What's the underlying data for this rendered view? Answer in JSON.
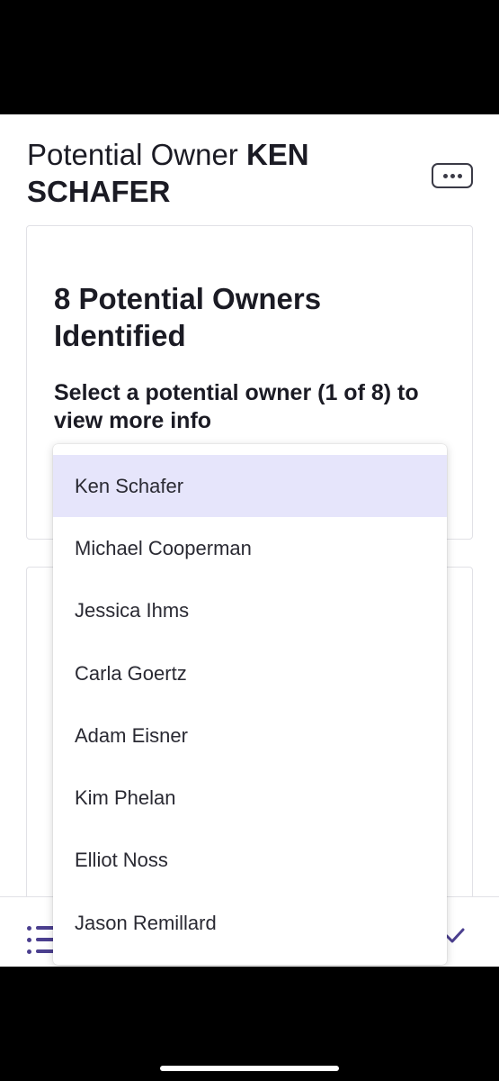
{
  "header": {
    "title_prefix": "Potential Owner ",
    "title_name": "KEN SCHAFER",
    "more_icon": "ellipsis-icon"
  },
  "card": {
    "heading": "8 Potential Owners Identified",
    "instruction": "Select a potential owner (1 of 8) to view more info"
  },
  "dropdown": {
    "selected_index": 0,
    "options": [
      "Ken Schafer",
      "Michael Cooperman",
      "Jessica Ihms",
      "Carla Goertz",
      "Adam Eisner",
      "Kim Phelan",
      "Elliot Noss",
      "Jason Remillard"
    ]
  },
  "bottom_nav": {
    "left_icon": "list-icon",
    "right_icon": "check-icon"
  },
  "colors": {
    "accent": "#4b3f8f",
    "selected_bg": "#e6e5fb",
    "text": "#1b1b24"
  }
}
